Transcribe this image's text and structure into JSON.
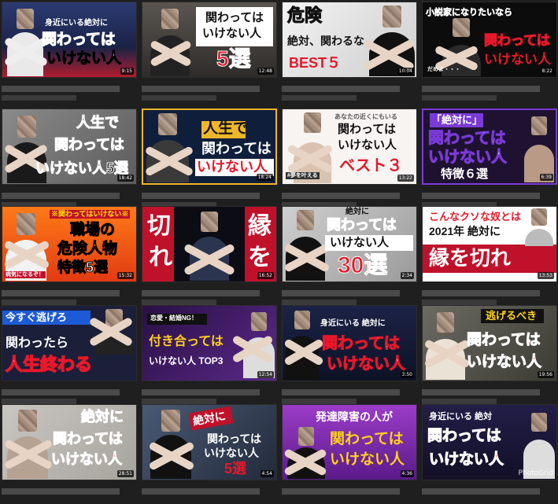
{
  "videos": [
    {
      "id": 1,
      "lines": [
        "身近にいる絶対に",
        "関わっては",
        "いけない人"
      ],
      "duration": "9:15"
    },
    {
      "id": 2,
      "lines": [
        "関わっては",
        "いけない人",
        "5選"
      ],
      "duration": "12:48"
    },
    {
      "id": 3,
      "lines": [
        "危険",
        "絶対、関わるな",
        "BEST５"
      ],
      "duration": "10:04"
    },
    {
      "id": 4,
      "lines": [
        "小説家になりたいなら",
        "関わっては",
        "いけない人",
        "だめよ・・・"
      ],
      "duration": "8:22"
    },
    {
      "id": 5,
      "lines": [
        "人生で",
        "関わっては",
        "いけない人5選"
      ],
      "duration": "18:42"
    },
    {
      "id": 6,
      "lines": [
        "人生で",
        "関わっては",
        "いけない人"
      ],
      "duration": "18:24"
    },
    {
      "id": 7,
      "lines": [
        "あなたの近くにもいる",
        "関わっては",
        "いけない人",
        "ベスト３",
        "#夢を叶える"
      ],
      "duration": "13:22"
    },
    {
      "id": 8,
      "lines": [
        "「絶対に」",
        "関わっては",
        "いけない人",
        "特徴６選"
      ],
      "duration": "6:39"
    },
    {
      "id": 9,
      "lines": [
        "※関わってはいけない※",
        "職場の",
        "危険人物",
        "特徴5選",
        "病気になるぞ！"
      ],
      "duration": "15:32"
    },
    {
      "id": 10,
      "lines": [
        "切",
        "れ",
        "縁",
        "を"
      ],
      "duration": "16:52"
    },
    {
      "id": 11,
      "lines": [
        "絶対に",
        "関わっては",
        "いけない人",
        "30選"
      ],
      "duration": "2:34"
    },
    {
      "id": 12,
      "lines": [
        "こんなクソな奴とは",
        "2021年 絶対に",
        "縁を切れ"
      ],
      "duration": "13:53"
    },
    {
      "id": 13,
      "lines": [
        "今すぐ逃げろ",
        "関わったら",
        "人生終わる"
      ],
      "duration": ""
    },
    {
      "id": 14,
      "lines": [
        "恋愛・結婚NG！",
        "付き合っては",
        "いけない人 TOP3"
      ],
      "duration": "12:54"
    },
    {
      "id": 15,
      "lines": [
        "身近にいる 絶対に",
        "関わっては",
        "いけない人"
      ],
      "duration": "3:50"
    },
    {
      "id": 16,
      "lines": [
        "逃げるべき",
        "関わっては",
        "いけない人"
      ],
      "duration": "19:56"
    },
    {
      "id": 17,
      "lines": [
        "絶対に",
        "関わっては",
        "いけない人"
      ],
      "duration": "28:51"
    },
    {
      "id": 18,
      "lines": [
        "絶対に",
        "関わっては",
        "いけない人",
        "5選"
      ],
      "duration": "4:54"
    },
    {
      "id": 19,
      "lines": [
        "発達障害の人が",
        "関わっては",
        "いけない人"
      ],
      "duration": "4:36"
    },
    {
      "id": 20,
      "lines": [
        "身近にいる 絶対",
        "関わっては",
        "いけない人"
      ],
      "duration": ""
    }
  ],
  "watermark": "PhotoGrid"
}
